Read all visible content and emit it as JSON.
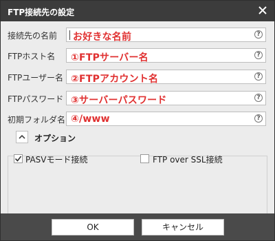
{
  "window": {
    "title": "FTP接続先の設定",
    "close_icon": "close-icon"
  },
  "fields": [
    {
      "label": "接続先の名前",
      "value": "お好きな名前",
      "has_cursor": true
    },
    {
      "label": "FTPホスト名",
      "value": "①FTPサーバー名"
    },
    {
      "label": "FTPユーザー名",
      "value": "②FTPアカウント名"
    },
    {
      "label": "FTPパスワード",
      "value": "③サーバーパスワード"
    },
    {
      "label": "初期フォルダ名",
      "value": "④/www"
    }
  ],
  "help_glyph": "?",
  "options": {
    "title": "オプション",
    "pasv": {
      "label": "PASVモード接続",
      "checked": true
    },
    "ssl": {
      "label": "FTP over SSL接続",
      "checked": false
    }
  },
  "buttons": {
    "ok": "OK",
    "cancel": "キャンセル"
  },
  "colors": {
    "titlebar": "#3c3c3c",
    "footer": "#4a4a4a",
    "value_text": "#e03030",
    "body": "#ececec"
  }
}
